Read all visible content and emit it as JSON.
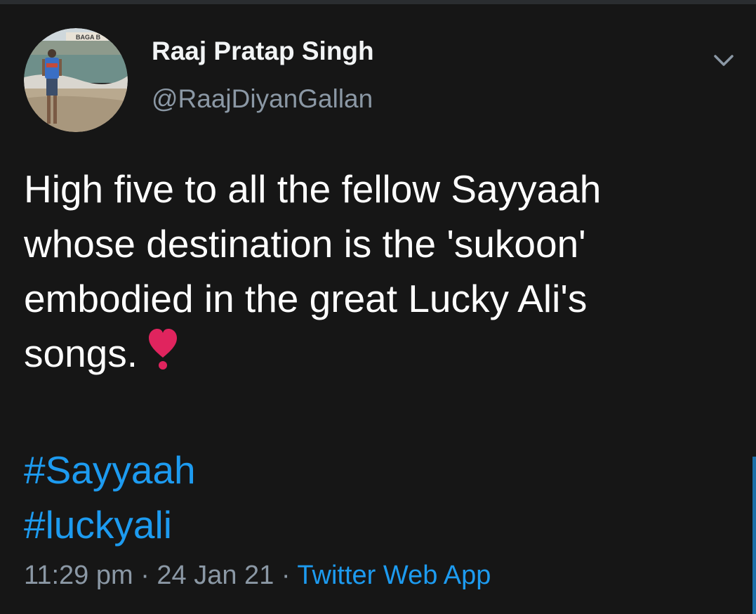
{
  "author": {
    "display_name": "Raaj Pratap Singh",
    "handle": "@RaajDiyanGallan",
    "avatar_sign_text": "BAGA B"
  },
  "tweet": {
    "lines": [
      "High five to all the fellow Sayyaah",
      "whose destination is the 'sukoon'",
      "embodied in the great Lucky Ali's",
      "songs."
    ],
    "emoji": "heavy-heart-exclamation-icon",
    "hashtags": [
      "#Sayyaah",
      "#luckyali"
    ]
  },
  "meta": {
    "time": "11:29 pm",
    "separator": "·",
    "date": "24 Jan 21",
    "source": "Twitter Web App"
  },
  "colors": {
    "background": "#161616",
    "text": "#ffffff",
    "muted": "#8b98a5",
    "link": "#1d9bf0",
    "heart": "#e0245e"
  },
  "icons": {
    "menu": "chevron-down-icon"
  }
}
